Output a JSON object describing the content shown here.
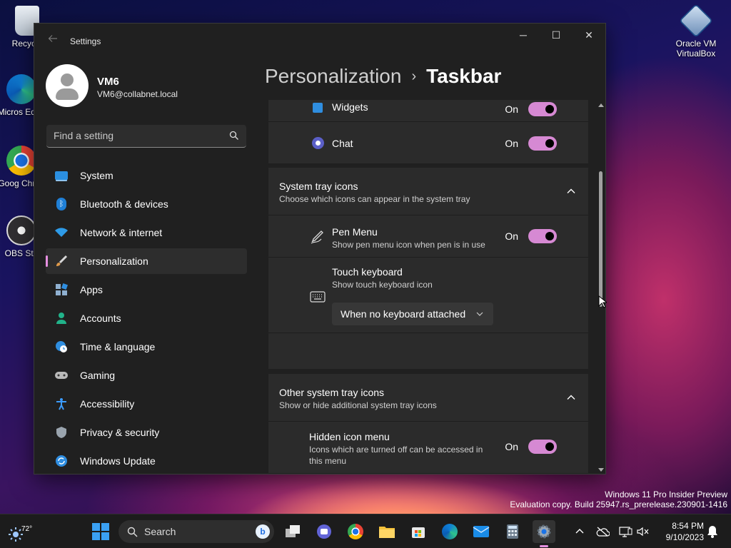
{
  "desktop": {
    "icons": [
      {
        "label": "Recycle",
        "icon": "recycle-bin-icon"
      },
      {
        "label": "Micros Edge",
        "icon": "edge-icon"
      },
      {
        "label": "Goog Chron",
        "icon": "chrome-icon"
      },
      {
        "label": "OBS Stu",
        "icon": "obs-icon"
      },
      {
        "label": "Oracle VM VirtualBox",
        "icon": "virtualbox-icon"
      }
    ]
  },
  "window": {
    "title": "Settings",
    "controls": {
      "minimize": "─",
      "maximize": "☐",
      "close": "✕"
    }
  },
  "profile": {
    "name": "VM6",
    "email": "VM6@collabnet.local"
  },
  "search": {
    "placeholder": "Find a setting"
  },
  "nav": {
    "items": [
      {
        "label": "System",
        "icon": "system-icon",
        "color": "#2b8fe0"
      },
      {
        "label": "Bluetooth & devices",
        "icon": "bluetooth-icon",
        "color": "#1f7fd6"
      },
      {
        "label": "Network & internet",
        "icon": "wifi-icon",
        "color": "#2e9be8"
      },
      {
        "label": "Personalization",
        "icon": "brush-icon",
        "color": "#e09a4a",
        "active": true
      },
      {
        "label": "Apps",
        "icon": "apps-icon",
        "color": "#8fb0d0"
      },
      {
        "label": "Accounts",
        "icon": "accounts-icon",
        "color": "#21b38a"
      },
      {
        "label": "Time & language",
        "icon": "globe-clock-icon",
        "color": "#2f8ee0"
      },
      {
        "label": "Gaming",
        "icon": "gamepad-icon",
        "color": "#b9b9b9"
      },
      {
        "label": "Accessibility",
        "icon": "accessibility-icon",
        "color": "#3c9cff"
      },
      {
        "label": "Privacy & security",
        "icon": "shield-icon",
        "color": "#9aa4ae"
      },
      {
        "label": "Windows Update",
        "icon": "update-icon",
        "color": "#2e8de0"
      }
    ]
  },
  "breadcrumb": {
    "parent": "Personalization",
    "separator": "›",
    "current": "Taskbar"
  },
  "content": {
    "widgets": {
      "label": "Widgets",
      "state": "On"
    },
    "chat": {
      "label": "Chat",
      "state": "On"
    },
    "system_tray": {
      "title": "System tray icons",
      "desc": "Choose which icons can appear in the system tray",
      "pen_menu": {
        "title": "Pen Menu",
        "desc": "Show pen menu icon when pen is in use",
        "state": "On"
      },
      "touch_keyboard": {
        "title": "Touch keyboard",
        "desc": "Show touch keyboard icon",
        "dropdown": "When no keyboard attached"
      }
    },
    "other_tray": {
      "title": "Other system tray icons",
      "desc": "Show or hide additional system tray icons",
      "hidden_menu": {
        "title": "Hidden icon menu",
        "desc_line1": "Icons which are turned off can be accessed in",
        "desc_line2": "this menu",
        "state": "On"
      }
    }
  },
  "watermark": {
    "line1": "Windows 11 Pro Insider Preview",
    "line2": "Evaluation copy. Build 25947.rs_prerelease.230901-1416"
  },
  "taskbar": {
    "weather_temp": "72°",
    "search_label": "Search",
    "bing_label": "b",
    "time": "8:54 PM",
    "date": "9/10/2023"
  },
  "colors": {
    "accent": "#d689d3",
    "window_bg": "#202020",
    "card_bg": "#2b2b2b"
  }
}
